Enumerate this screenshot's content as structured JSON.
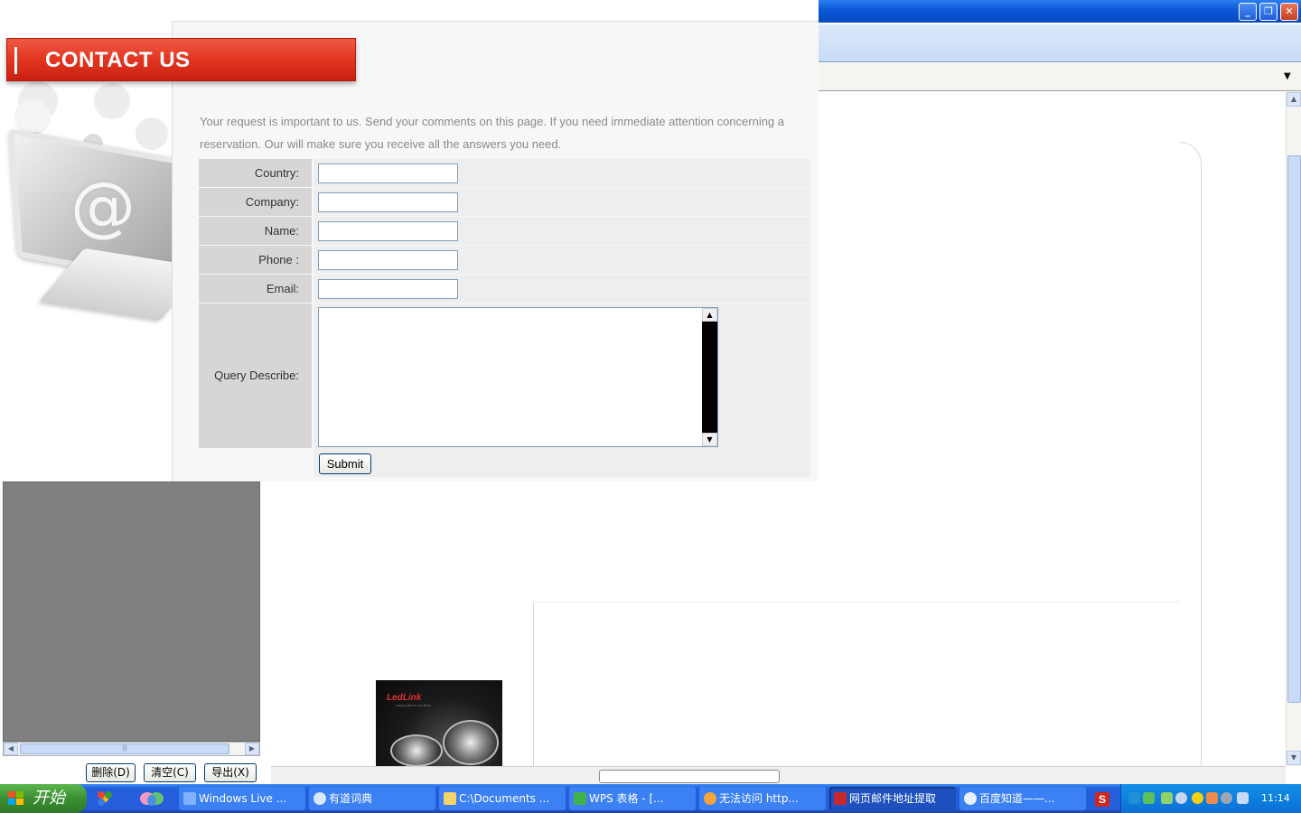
{
  "window": {
    "controls": {
      "minimize_icon": "minimize-icon",
      "restore_icon": "restore-icon",
      "close_icon": "close-icon"
    }
  },
  "contact": {
    "banner": "CONTACT US",
    "intro": "Your request is important to us. Send your comments on this page. If you need immediate attention concerning a reservation. Our will make sure you receive all the answers you need.",
    "fields": [
      {
        "label": "Country:",
        "value": ""
      },
      {
        "label": "Company:",
        "value": ""
      },
      {
        "label": "Name:",
        "value": ""
      },
      {
        "label": "Phone :",
        "value": ""
      },
      {
        "label": "Email:",
        "value": ""
      }
    ],
    "query_label": "Query Describe:",
    "query_value": "",
    "submit_label": "Submit"
  },
  "product": {
    "brand": "LedLink",
    "tagline": "Leading LEDs for Your World"
  },
  "tool_buttons": {
    "delete": "删除(D)",
    "clear": "清空(C)",
    "export": "导出(X)"
  },
  "taskbar": {
    "start": "开始",
    "tasks": [
      {
        "label": "Windows Live ...",
        "active": false,
        "color": "#7fb2ff"
      },
      {
        "label": "有道词典",
        "active": false,
        "color": "#d9e8ff"
      },
      {
        "label": "C:\\Documents ...",
        "active": false,
        "color": "#f3d36a"
      },
      {
        "label": "WPS 表格 - [...",
        "active": false,
        "color": "#3fb24a"
      },
      {
        "label": "无法访问 http...",
        "active": false,
        "color": "#f3a43a"
      },
      {
        "label": "网页邮件地址提取",
        "active": true,
        "color": "#c8272b"
      },
      {
        "label": "百度知道——...",
        "active": false,
        "color": "#e8f0ff"
      }
    ],
    "wps_tray": "S",
    "clock": "11:14"
  },
  "colors": {
    "banner_red": "#e33923",
    "taskbar_blue": "#245edb",
    "start_green": "#3c8f33"
  }
}
